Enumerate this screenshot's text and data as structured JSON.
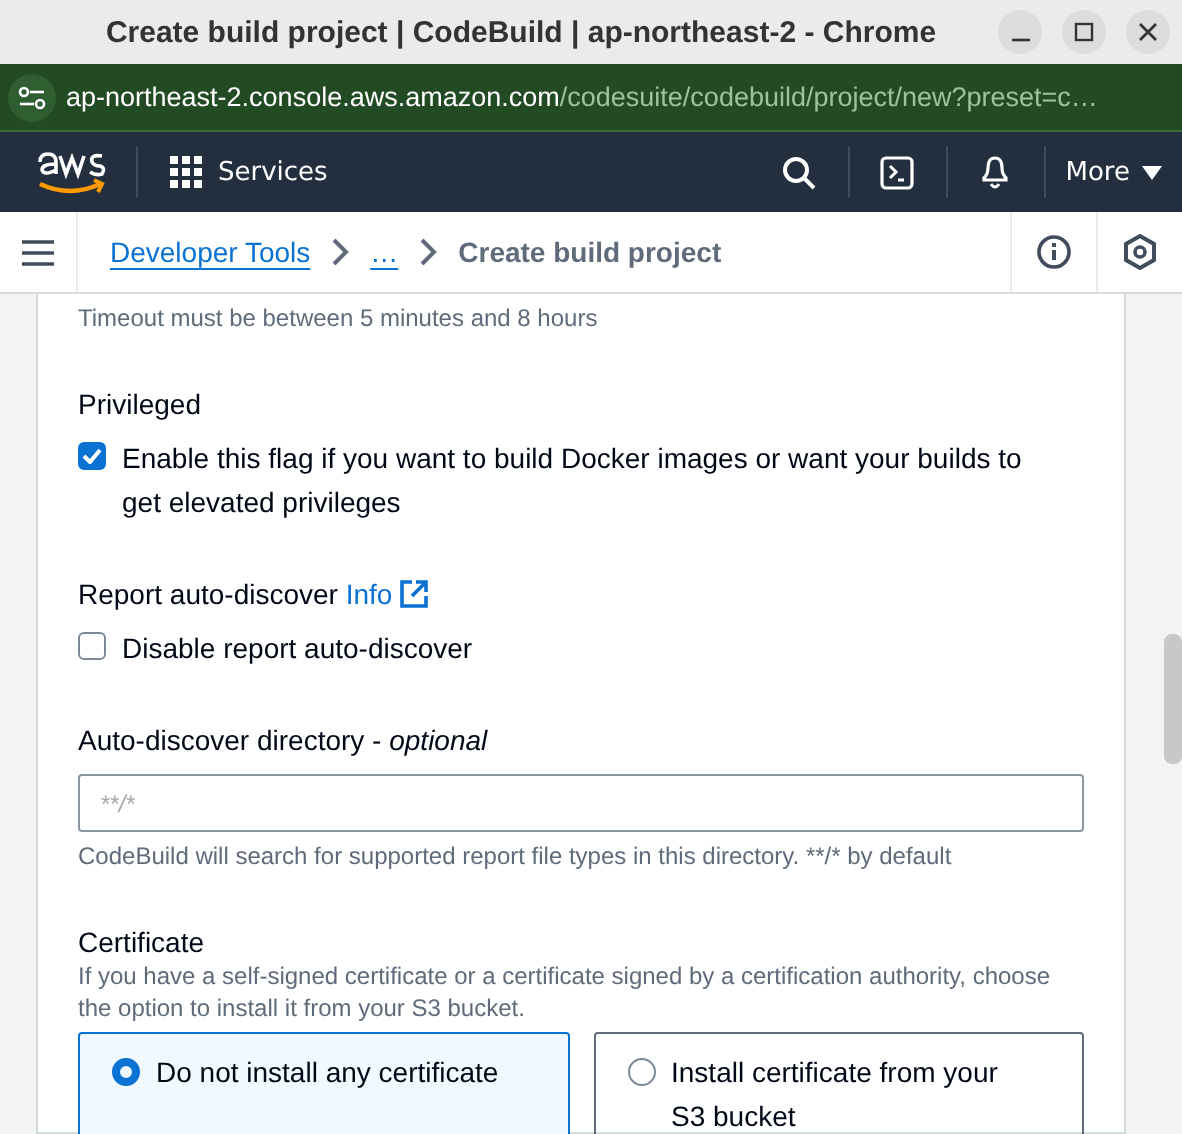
{
  "window": {
    "title": "Create build project | CodeBuild | ap-northeast-2 - Chrome"
  },
  "address_bar": {
    "host": "ap-northeast-2.console.aws.amazon.com",
    "path": "/codesuite/codebuild/project/new?preset=c…"
  },
  "top_nav": {
    "services": "Services",
    "more": "More"
  },
  "breadcrumbs": [
    {
      "label": "Developer Tools",
      "kind": "link"
    },
    {
      "label": "…",
      "kind": "link"
    },
    {
      "label": "Create build project",
      "kind": "current"
    }
  ],
  "form": {
    "timeout_hint": "Timeout must be between 5 minutes and 8 hours",
    "privileged": {
      "label": "Privileged",
      "option": "Enable this flag if you want to build Docker images or want your builds to get elevated privileges",
      "checked": true
    },
    "report_auto_discover": {
      "label": "Report auto-discover",
      "info": "Info",
      "option": "Disable report auto-discover",
      "checked": false
    },
    "directory": {
      "label": "Auto-discover directory - *optional*",
      "placeholder": "**/*",
      "hint": "CodeBuild will search for supported report file types in this directory. **/* by default"
    },
    "certificate": {
      "label": "Certificate",
      "description": "If you have a self-signed certificate or a certificate signed by a certification authority, choose the option to install it from your S3 bucket.",
      "options": [
        {
          "label": "Do not install any certificate",
          "selected": true
        },
        {
          "label": "Install certificate from your S3 bucket",
          "selected": false
        }
      ]
    }
  }
}
